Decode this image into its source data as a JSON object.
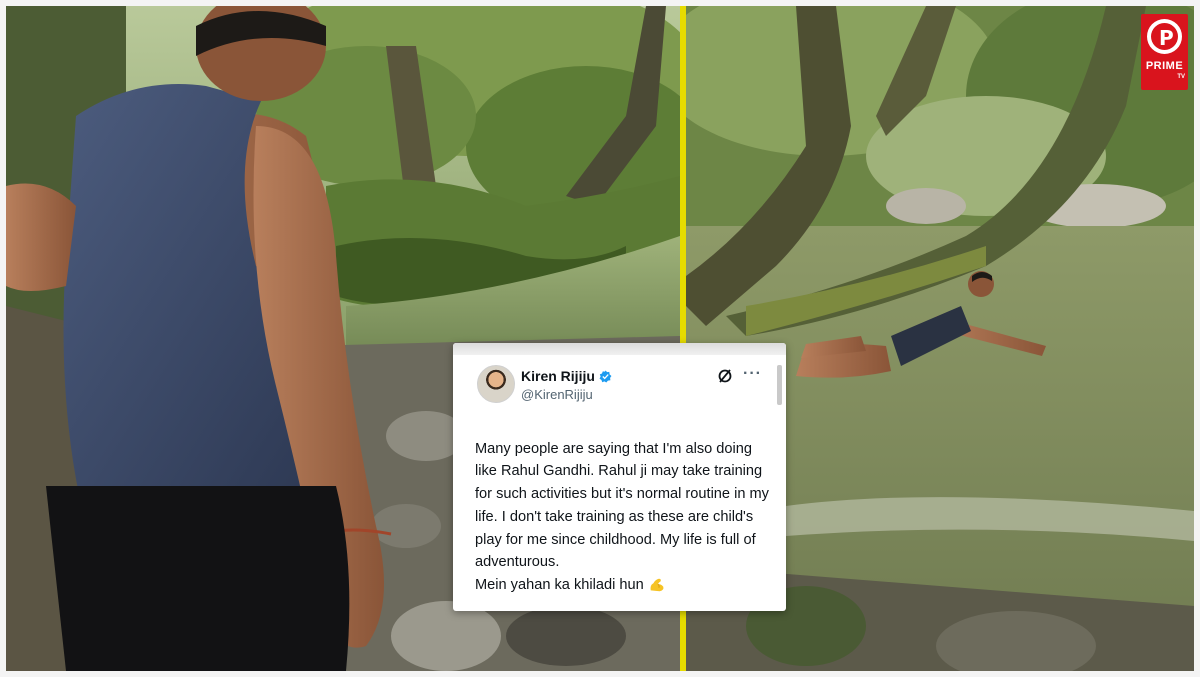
{
  "tweet": {
    "author_name": "Kiren Rijiju",
    "author_handle": "@KirenRijiju",
    "verified_icon": "verified-badge-icon",
    "body": "Many people are saying that I'm also doing like Rahul Gandhi. Rahul ji may take training for such activities but it's normal routine in my life. I don't take training as these are child's play for me since childhood. My life is full of adventurous.",
    "last_line": "Mein yahan ka khiladi hun",
    "emoji_icon": "flexed-biceps-icon",
    "more_label": "···"
  },
  "logo": {
    "brand": "PRIME",
    "sub": "TV",
    "color": "#d9141d"
  },
  "colors": {
    "divider": "#e6dc00",
    "verified": "#1d9bf0"
  }
}
